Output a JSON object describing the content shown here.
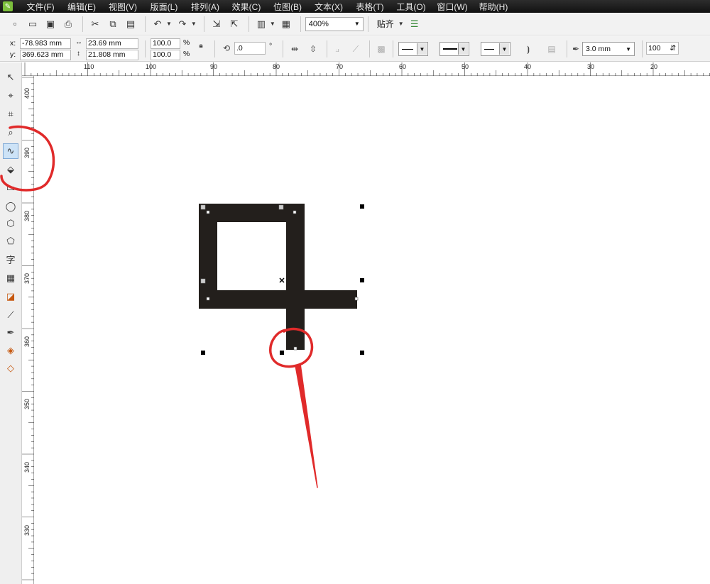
{
  "menubar": {
    "items": [
      "文件(F)",
      "编辑(E)",
      "视图(V)",
      "版面(L)",
      "排列(A)",
      "效果(C)",
      "位图(B)",
      "文本(X)",
      "表格(T)",
      "工具(O)",
      "窗口(W)",
      "帮助(H)"
    ]
  },
  "toolbar": {
    "zoom_value": "400%",
    "snap_label": "贴齐"
  },
  "property_bar": {
    "x_label": "x:",
    "x_value": "-78.983 mm",
    "y_label": "y:",
    "y_value": "369.623 mm",
    "width_value": "23.69 mm",
    "height_value": "21.808 mm",
    "scale_x": "100.0",
    "scale_y": "100.0",
    "percent": "%",
    "rotation_value": ".0",
    "degree": "°",
    "outline_width": "3.0 mm",
    "miter_value": "100"
  },
  "ruler": {
    "top_labels": [
      "110",
      "100",
      "90",
      "80",
      "70",
      "60",
      "50",
      "40",
      "30",
      "20"
    ],
    "left_labels": [
      "400",
      "390",
      "380",
      "370",
      "360",
      "350",
      "340",
      "330"
    ]
  },
  "colors": {
    "shape_fill": "#231f1c",
    "annotation_red": "#e02a2a",
    "menubar_bg": "#1e1e1e",
    "selected_tool": "#cde3f7"
  },
  "icons": {
    "toolbox": [
      "pick-tool-icon",
      "shape-tool-icon",
      "crop-tool-icon",
      "zoom-tool-icon",
      "freehand-tool-icon",
      "smart-fill-tool-icon",
      "rectangle-tool-icon",
      "ellipse-tool-icon",
      "polygon-tool-icon",
      "basic-shapes-tool-icon",
      "text-tool-icon",
      "table-tool-icon",
      "interactive-effects-tool-icon",
      "eyedropper-tool-icon",
      "outline-pen-tool-icon",
      "fill-tool-icon",
      "interactive-fill-tool-icon"
    ]
  }
}
